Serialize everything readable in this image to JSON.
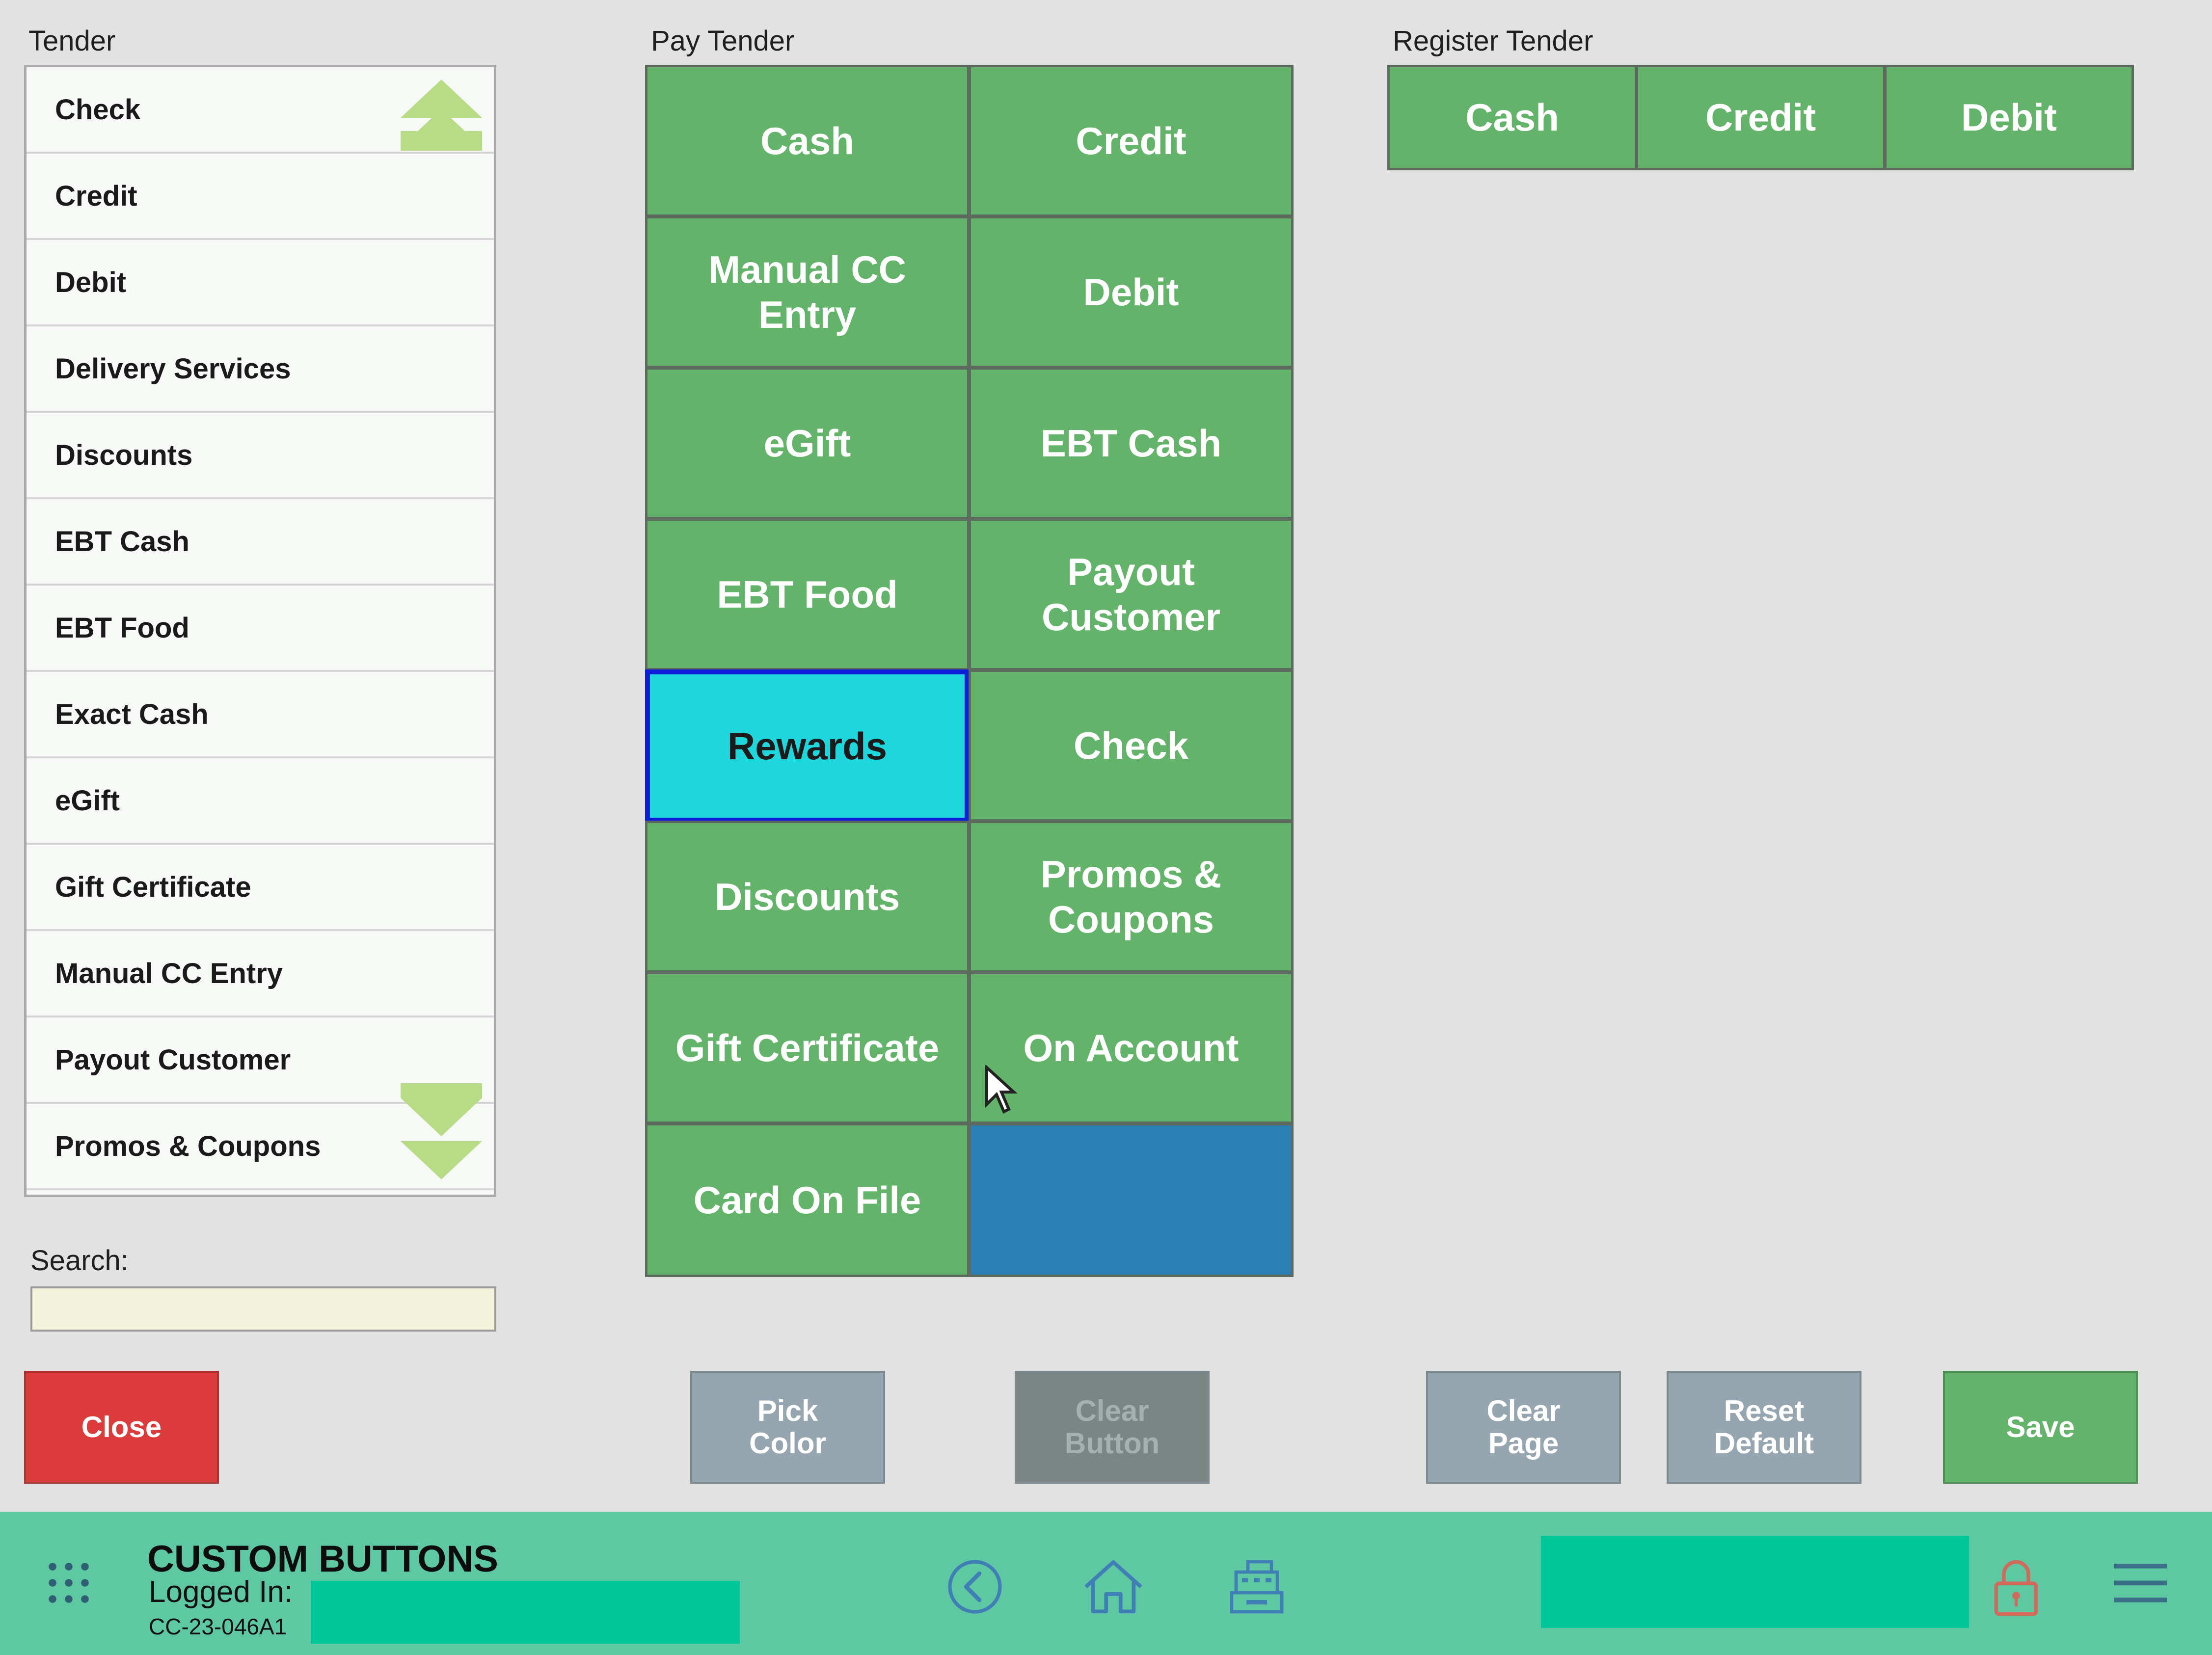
{
  "tender": {
    "label": "Tender",
    "items": [
      "Check",
      "Credit",
      "Debit",
      "Delivery Services",
      "Discounts",
      "EBT Cash",
      "EBT Food",
      "Exact Cash",
      "eGift",
      "Gift Certificate",
      "Manual CC Entry",
      "Payout Customer",
      "Promos & Coupons"
    ]
  },
  "search": {
    "label": "Search:",
    "value": ""
  },
  "pay_tender": {
    "label": "Pay Tender",
    "buttons": [
      "Cash",
      "Credit",
      "Manual CC\nEntry",
      "Debit",
      "eGift",
      "EBT Cash",
      "EBT Food",
      "Payout\nCustomer",
      "Rewards",
      "Check",
      "Discounts",
      "Promos &\nCoupons",
      "Gift Certificate",
      "On Account",
      "Card On File",
      ""
    ]
  },
  "register_tender": {
    "label": "Register Tender",
    "buttons": [
      "Cash",
      "Credit",
      "Debit"
    ]
  },
  "actions": {
    "close": "Close",
    "pick_color": "Pick\nColor",
    "clear_button": "Clear\nButton",
    "clear_page": "Clear\nPage",
    "reset_default": "Reset\nDefault",
    "save": "Save"
  },
  "footer": {
    "title": "CUSTOM BUTTONS",
    "logged_in_label": "Logged In:",
    "device_id": "CC-23-046A1"
  },
  "colors": {
    "tender_green": "#63b36a",
    "selected_cyan": "#1fd6dc",
    "selected_border": "#0b1fd6",
    "empty_blue": "#2a7fb6",
    "close_red": "#db3b3b",
    "footer_teal": "#5ec8a3"
  }
}
